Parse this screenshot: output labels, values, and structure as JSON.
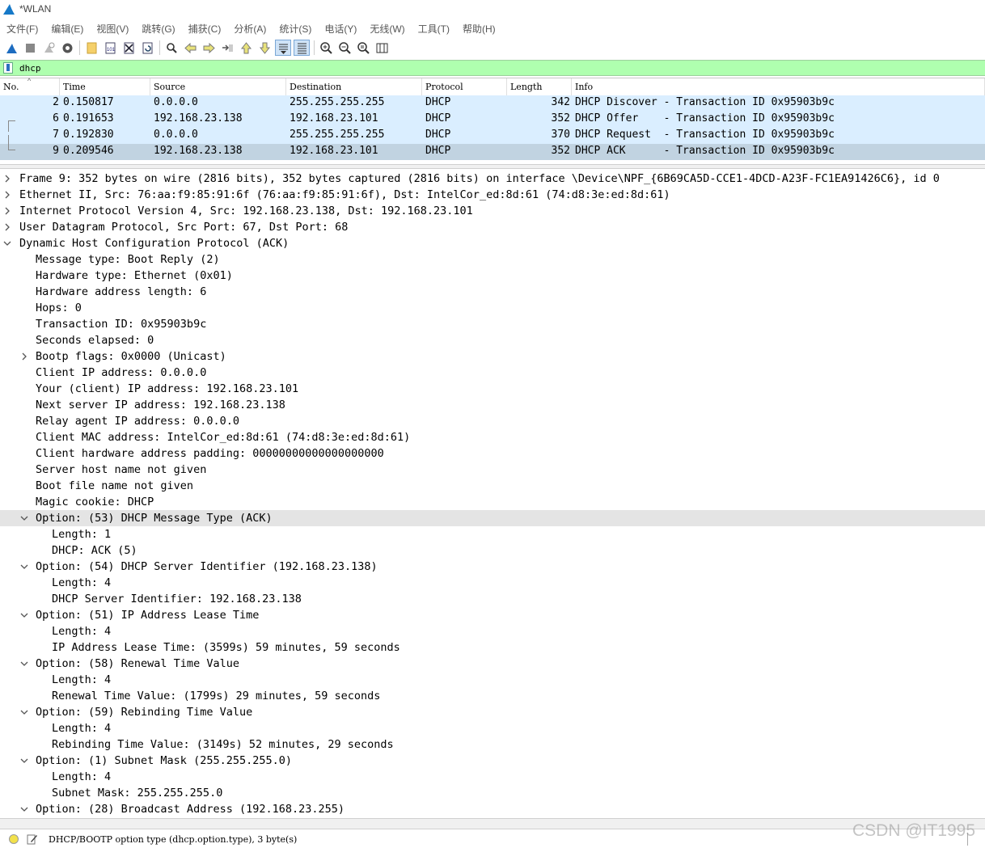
{
  "window": {
    "title": "*WLAN"
  },
  "menu": [
    "文件(F)",
    "编辑(E)",
    "视图(V)",
    "跳转(G)",
    "捕获(C)",
    "分析(A)",
    "统计(S)",
    "电话(Y)",
    "无线(W)",
    "工具(T)",
    "帮助(H)"
  ],
  "toolbar": {
    "buttons": [
      "start-capture-icon",
      "stop-capture-icon",
      "restart-capture-icon",
      "capture-options-icon",
      "open-file-icon",
      "save-file-icon",
      "close-file-icon",
      "reload-file-icon",
      "find-packet-icon",
      "go-back-icon",
      "go-forward-icon",
      "go-to-packet-icon",
      "first-packet-icon",
      "last-packet-icon",
      "autoscroll-icon",
      "colorize-icon",
      "zoom-in-icon",
      "zoom-out-icon",
      "normal-size-icon",
      "resize-columns-icon"
    ],
    "active": [
      "autoscroll-icon",
      "colorize-icon"
    ]
  },
  "filter": {
    "value": "dhcp"
  },
  "packet_list": {
    "columns": [
      "No.",
      "Time",
      "Source",
      "Destination",
      "Protocol",
      "Length",
      "Info"
    ],
    "rows": [
      {
        "no": "2",
        "time": "0.150817",
        "source": "0.0.0.0",
        "destination": "255.255.255.255",
        "protocol": "DHCP",
        "length": "342",
        "info": "DHCP Discover - Transaction ID 0x95903b9c"
      },
      {
        "no": "6",
        "time": "0.191653",
        "source": "192.168.23.138",
        "destination": "192.168.23.101",
        "protocol": "DHCP",
        "length": "352",
        "info": "DHCP Offer    - Transaction ID 0x95903b9c"
      },
      {
        "no": "7",
        "time": "0.192830",
        "source": "0.0.0.0",
        "destination": "255.255.255.255",
        "protocol": "DHCP",
        "length": "370",
        "info": "DHCP Request  - Transaction ID 0x95903b9c"
      },
      {
        "no": "9",
        "time": "0.209546",
        "source": "192.168.23.138",
        "destination": "192.168.23.101",
        "protocol": "DHCP",
        "length": "352",
        "info": "DHCP ACK      - Transaction ID 0x95903b9c"
      }
    ],
    "selected_no": "9"
  },
  "details": [
    {
      "level": 0,
      "expander": "collapsed",
      "text": "Frame 9: 352 bytes on wire (2816 bits), 352 bytes captured (2816 bits) on interface \\Device\\NPF_{6B69CA5D-CCE1-4DCD-A23F-FC1EA91426C6}, id 0"
    },
    {
      "level": 0,
      "expander": "collapsed",
      "text": "Ethernet II, Src: 76:aa:f9:85:91:6f (76:aa:f9:85:91:6f), Dst: IntelCor_ed:8d:61 (74:d8:3e:ed:8d:61)"
    },
    {
      "level": 0,
      "expander": "collapsed",
      "text": "Internet Protocol Version 4, Src: 192.168.23.138, Dst: 192.168.23.101"
    },
    {
      "level": 0,
      "expander": "collapsed",
      "text": "User Datagram Protocol, Src Port: 67, Dst Port: 68"
    },
    {
      "level": 0,
      "expander": "expanded",
      "text": "Dynamic Host Configuration Protocol (ACK)"
    },
    {
      "level": 1,
      "expander": "none",
      "text": "Message type: Boot Reply (2)"
    },
    {
      "level": 1,
      "expander": "none",
      "text": "Hardware type: Ethernet (0x01)"
    },
    {
      "level": 1,
      "expander": "none",
      "text": "Hardware address length: 6"
    },
    {
      "level": 1,
      "expander": "none",
      "text": "Hops: 0"
    },
    {
      "level": 1,
      "expander": "none",
      "text": "Transaction ID: 0x95903b9c"
    },
    {
      "level": 1,
      "expander": "none",
      "text": "Seconds elapsed: 0"
    },
    {
      "level": 1,
      "expander": "collapsed",
      "text": "Bootp flags: 0x0000 (Unicast)"
    },
    {
      "level": 1,
      "expander": "none",
      "text": "Client IP address: 0.0.0.0"
    },
    {
      "level": 1,
      "expander": "none",
      "text": "Your (client) IP address: 192.168.23.101"
    },
    {
      "level": 1,
      "expander": "none",
      "text": "Next server IP address: 192.168.23.138"
    },
    {
      "level": 1,
      "expander": "none",
      "text": "Relay agent IP address: 0.0.0.0"
    },
    {
      "level": 1,
      "expander": "none",
      "text": "Client MAC address: IntelCor_ed:8d:61 (74:d8:3e:ed:8d:61)"
    },
    {
      "level": 1,
      "expander": "none",
      "text": "Client hardware address padding: 00000000000000000000"
    },
    {
      "level": 1,
      "expander": "none",
      "text": "Server host name not given"
    },
    {
      "level": 1,
      "expander": "none",
      "text": "Boot file name not given"
    },
    {
      "level": 1,
      "expander": "none",
      "text": "Magic cookie: DHCP"
    },
    {
      "level": 1,
      "expander": "expanded",
      "text": "Option: (53) DHCP Message Type (ACK)",
      "highlight": true
    },
    {
      "level": 2,
      "expander": "none",
      "text": "Length: 1"
    },
    {
      "level": 2,
      "expander": "none",
      "text": "DHCP: ACK (5)"
    },
    {
      "level": 1,
      "expander": "expanded",
      "text": "Option: (54) DHCP Server Identifier (192.168.23.138)"
    },
    {
      "level": 2,
      "expander": "none",
      "text": "Length: 4"
    },
    {
      "level": 2,
      "expander": "none",
      "text": "DHCP Server Identifier: 192.168.23.138"
    },
    {
      "level": 1,
      "expander": "expanded",
      "text": "Option: (51) IP Address Lease Time"
    },
    {
      "level": 2,
      "expander": "none",
      "text": "Length: 4"
    },
    {
      "level": 2,
      "expander": "none",
      "text": "IP Address Lease Time: (3599s) 59 minutes, 59 seconds"
    },
    {
      "level": 1,
      "expander": "expanded",
      "text": "Option: (58) Renewal Time Value"
    },
    {
      "level": 2,
      "expander": "none",
      "text": "Length: 4"
    },
    {
      "level": 2,
      "expander": "none",
      "text": "Renewal Time Value: (1799s) 29 minutes, 59 seconds"
    },
    {
      "level": 1,
      "expander": "expanded",
      "text": "Option: (59) Rebinding Time Value"
    },
    {
      "level": 2,
      "expander": "none",
      "text": "Length: 4"
    },
    {
      "level": 2,
      "expander": "none",
      "text": "Rebinding Time Value: (3149s) 52 minutes, 29 seconds"
    },
    {
      "level": 1,
      "expander": "expanded",
      "text": "Option: (1) Subnet Mask (255.255.255.0)"
    },
    {
      "level": 2,
      "expander": "none",
      "text": "Length: 4"
    },
    {
      "level": 2,
      "expander": "none",
      "text": "Subnet Mask: 255.255.255.0"
    },
    {
      "level": 1,
      "expander": "expanded",
      "text": "Option: (28) Broadcast Address (192.168.23.255)"
    }
  ],
  "status": {
    "text": "DHCP/BOOTP option type (dhcp.option.type), 3 byte(s)"
  },
  "watermark": "CSDN @IT1995",
  "colors": {
    "row_bg": "#daeeff",
    "selected_bg": "#c1d3e1",
    "filter_bg": "#afffaf",
    "highlight_bg": "#e4e4e4"
  }
}
